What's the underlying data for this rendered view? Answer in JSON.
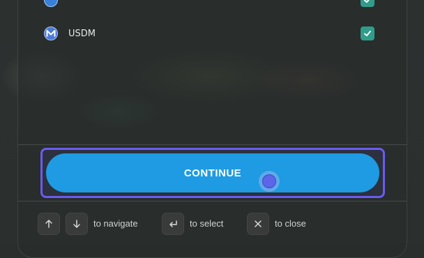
{
  "tokens": [
    {
      "label": "",
      "icon": "token-icon",
      "checked": true
    },
    {
      "label": "USDM",
      "icon": "usdm-m-icon",
      "checked": true
    }
  ],
  "continue_label": "CONTINUE",
  "footer": {
    "navigate_hint": "to navigate",
    "select_hint": "to select",
    "close_hint": "to close"
  },
  "colors": {
    "accent": "#1e9be2",
    "focus": "#6a5cf0",
    "check": "#2f9d8a"
  }
}
